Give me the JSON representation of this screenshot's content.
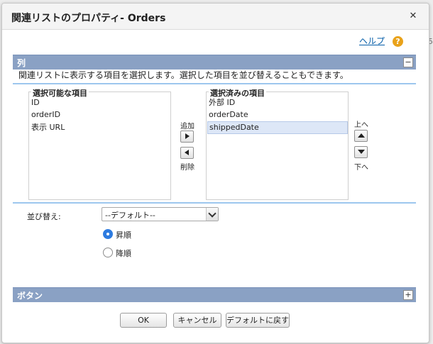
{
  "background": {
    "fragment_right": "5"
  },
  "dialog": {
    "title": "関連リストのプロパティ- Orders",
    "close_icon": "close-icon"
  },
  "help": {
    "link_label": "ヘルプ",
    "icon_glyph": "?"
  },
  "columns_section": {
    "header": "列",
    "toggle": "−",
    "description": "関連リストに表示する項目を選択します。選択した項目を並び替えることもできます。",
    "available": {
      "legend": "選択可能な項目",
      "items": [
        "ID",
        "orderID",
        "表示 URL"
      ]
    },
    "selected": {
      "legend": "選択済みの項目",
      "items": [
        "外部 ID",
        "orderDate",
        "shippedDate"
      ],
      "highlighted_index": 2
    },
    "add_label": "追加",
    "remove_label": "削除",
    "up_label": "上へ",
    "down_label": "下へ"
  },
  "sort": {
    "label": "並び替え:",
    "selected_value": "--デフォルト--",
    "ascending_label": "昇順",
    "descending_label": "降順",
    "ascending_checked": true
  },
  "buttons_section": {
    "header": "ボタン",
    "toggle": "+"
  },
  "footer": {
    "ok_label": "OK",
    "cancel_label": "キャンセル",
    "reset_label": "デフォルトに戻す"
  },
  "colors": {
    "section_header": "#8aa1c4",
    "accent_rule": "#9dc7ee",
    "link": "#015ba7",
    "help_icon": "#e9a21a",
    "radio_selected": "#2d7be0"
  }
}
